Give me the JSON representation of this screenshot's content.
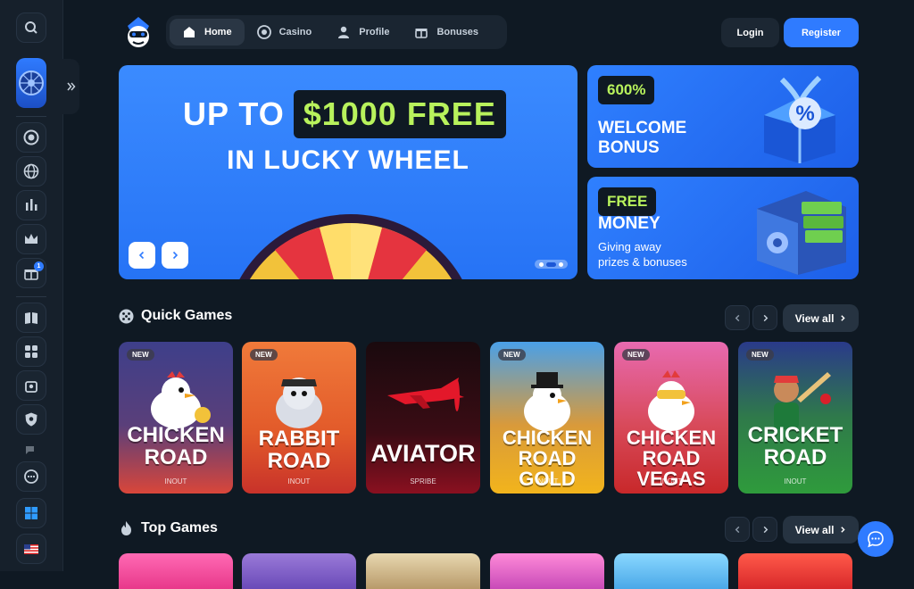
{
  "header": {
    "nav": [
      {
        "label": "Home",
        "icon": "home-icon",
        "active": true
      },
      {
        "label": "Casino",
        "icon": "chip-icon",
        "active": false
      },
      {
        "label": "Profile",
        "icon": "user-icon",
        "active": false
      },
      {
        "label": "Bonuses",
        "icon": "gift-icon",
        "active": false
      }
    ],
    "login_label": "Login",
    "register_label": "Register"
  },
  "sidebar": {
    "icons": [
      "search-icon",
      "lucky-wheel-icon",
      "expand-icon",
      "chip-icon",
      "globe-icon",
      "chart-icon",
      "crown-icon",
      "gift-icon",
      "book-icon",
      "gamepad-icon",
      "bag-icon",
      "shield-icon",
      "chat-bubbles-icon",
      "windows-icon",
      "us-flag-icon"
    ],
    "gift_badge": "1"
  },
  "hero": {
    "line1_prefix": "UP TO",
    "line1_highlight": "$1000 FREE",
    "line2": "IN LUCKY WHEEL"
  },
  "promos": [
    {
      "tag": "600%",
      "title_lines": [
        "WELCOME",
        "BONUS"
      ],
      "subtitle_lines": []
    },
    {
      "tag": "FREE",
      "title_lines": [
        "MONEY"
      ],
      "subtitle_lines": [
        "Giving away",
        "prizes & bonuses"
      ]
    }
  ],
  "quick_games": {
    "title": "Quick Games",
    "view_all": "View all",
    "games": [
      {
        "name_lines": [
          "CHICKEN",
          "ROAD"
        ],
        "provider": "INOUT",
        "new": "NEW",
        "color": "#3e3f8a"
      },
      {
        "name_lines": [
          "RABBIT",
          "ROAD"
        ],
        "provider": "INOUT",
        "new": "NEW",
        "color": "#e25a2a"
      },
      {
        "name_lines": [
          "AVIATOR"
        ],
        "provider": "SPRIBE",
        "new": "",
        "color": "#2a0a10"
      },
      {
        "name_lines": [
          "CHICKEN",
          "ROAD GOLD"
        ],
        "provider": "INOUT",
        "new": "NEW",
        "color": "#e8a21c"
      },
      {
        "name_lines": [
          "CHICKEN",
          "ROAD VEGAS"
        ],
        "provider": "INOUT",
        "new": "NEW",
        "color": "#d84a5a"
      },
      {
        "name_lines": [
          "CRICKET",
          "ROAD"
        ],
        "provider": "INOUT",
        "new": "NEW",
        "color": "#2f9b3c"
      }
    ]
  },
  "top_games": {
    "title": "Top Games",
    "view_all": "View all"
  },
  "colors": {
    "accent": "#2f7bff",
    "highlight_green": "#b8f25c",
    "background": "#0f1923"
  }
}
